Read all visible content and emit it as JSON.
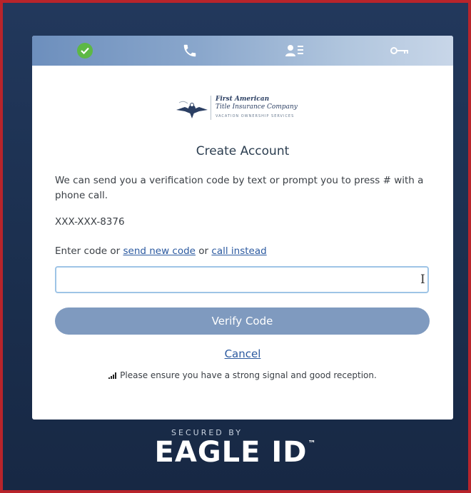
{
  "steps": [
    {
      "icon": "check-icon",
      "status": "complete"
    },
    {
      "icon": "phone-icon",
      "status": "current"
    },
    {
      "icon": "contact-card-icon",
      "status": "upcoming"
    },
    {
      "icon": "key-icon",
      "status": "upcoming"
    }
  ],
  "logo": {
    "line1": "First American",
    "line2": "Title Insurance Company",
    "line3": "VACATION OWNERSHIP SERVICES"
  },
  "title": "Create Account",
  "description": "We can send you a verification code by text or prompt you to press # with a phone call.",
  "phone_masked": "XXX-XXX-8376",
  "code_prompt": {
    "prefix": "Enter code or ",
    "send_link": "send new code",
    "middle": " or ",
    "call_link": "call instead"
  },
  "code_input": {
    "value": "",
    "placeholder": ""
  },
  "verify_button": "Verify Code",
  "cancel_link": "Cancel",
  "signal_note": "Please ensure you have a strong signal and good reception.",
  "footer": {
    "secured_by": "SECURED BY",
    "brand": "EAGLE ID",
    "trademark": "™"
  },
  "colors": {
    "step_complete": "#5db845",
    "button": "#7f9abf",
    "link": "#2c5aa0",
    "background": "#1f3456"
  }
}
